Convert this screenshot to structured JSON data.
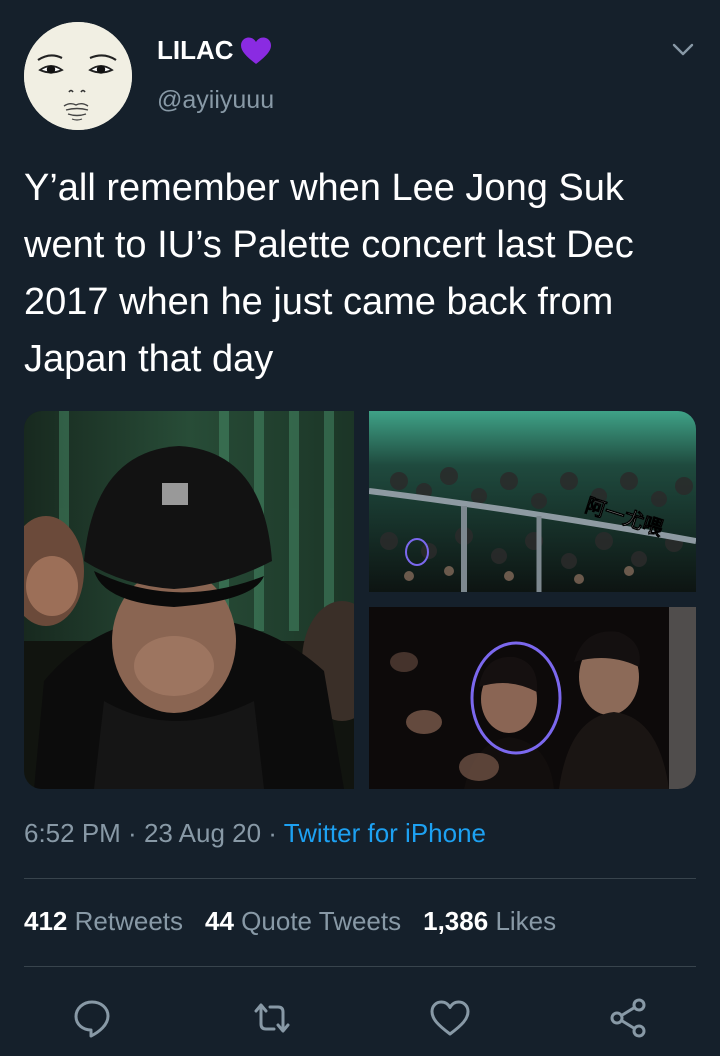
{
  "user": {
    "name": "LILAC",
    "handle": "@ayiiyuuu"
  },
  "tweet": {
    "text": "Y’all remember when Lee Jong Suk went to IU’s Palette concert last Dec 2017 when he just came back from Japan that day"
  },
  "media": {
    "overlay_text": "阿一尤喂"
  },
  "meta": {
    "time": "6:52 PM",
    "sep1": " · ",
    "date": "23 Aug 20",
    "sep2": " · ",
    "source": "Twitter for iPhone"
  },
  "stats": {
    "retweets_count": "412",
    "retweets_label": "Retweets",
    "quotes_count": "44",
    "quotes_label": "Quote Tweets",
    "likes_count": "1,386",
    "likes_label": "Likes"
  },
  "icons": {
    "reply": "reply-icon",
    "retweet": "retweet-icon",
    "like": "like-icon",
    "share": "share-icon",
    "more": "chevron-down-icon",
    "emoji": "purple-heart-icon"
  },
  "colors": {
    "background": "#15202b",
    "secondary_text": "#8899a6",
    "link": "#1da1f2",
    "divider": "#38444d",
    "purple_heart": "#8a2be2",
    "circle_highlight": "#7b68ee"
  }
}
